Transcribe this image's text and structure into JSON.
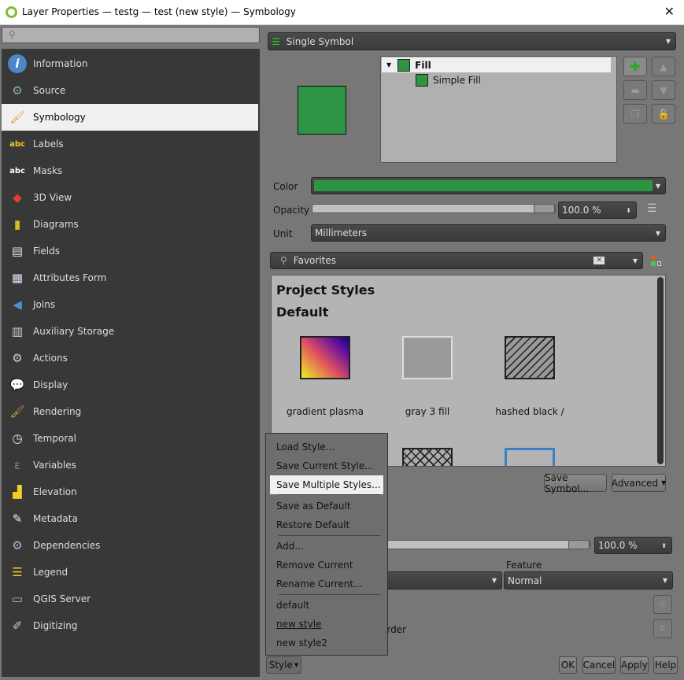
{
  "window": {
    "title": "Layer Properties — testg — test (new style) — Symbology",
    "close_icon": "close-icon"
  },
  "sidebar": {
    "search_placeholder": "",
    "items": [
      {
        "label": "Information",
        "icon": "info-icon",
        "color": "#4a86c8",
        "glyph": "i"
      },
      {
        "label": "Source",
        "icon": "source-icon",
        "color": "#8aa",
        "glyph": "⚙"
      },
      {
        "label": "Symbology",
        "icon": "symbology-icon",
        "color": "#d9a040",
        "glyph": "🖌"
      },
      {
        "label": "Labels",
        "icon": "labels-icon",
        "color": "#f0d020",
        "glyph": "abc"
      },
      {
        "label": "Masks",
        "icon": "masks-icon",
        "color": "#fff",
        "glyph": "abc"
      },
      {
        "label": "3D View",
        "icon": "3d-view-icon",
        "color": "#e04030",
        "glyph": "◆"
      },
      {
        "label": "Diagrams",
        "icon": "diagrams-icon",
        "color": "#d0c020",
        "glyph": "▮"
      },
      {
        "label": "Fields",
        "icon": "fields-icon",
        "color": "#d8e4f0",
        "glyph": "▤"
      },
      {
        "label": "Attributes Form",
        "icon": "attributes-form-icon",
        "color": "#d8e4f0",
        "glyph": "▦"
      },
      {
        "label": "Joins",
        "icon": "joins-icon",
        "color": "#5090d0",
        "glyph": "◀"
      },
      {
        "label": "Auxiliary Storage",
        "icon": "auxiliary-storage-icon",
        "color": "#ccc",
        "glyph": "▥"
      },
      {
        "label": "Actions",
        "icon": "actions-icon",
        "color": "#ccc",
        "glyph": "⚙"
      },
      {
        "label": "Display",
        "icon": "display-icon",
        "color": "#f0e090",
        "glyph": "💬"
      },
      {
        "label": "Rendering",
        "icon": "rendering-icon",
        "color": "#d9a040",
        "glyph": "🖌"
      },
      {
        "label": "Temporal",
        "icon": "temporal-icon",
        "color": "#eee",
        "glyph": "◷"
      },
      {
        "label": "Variables",
        "icon": "variables-icon",
        "color": "#888",
        "glyph": "ε"
      },
      {
        "label": "Elevation",
        "icon": "elevation-icon",
        "color": "#f0d020",
        "glyph": "▟"
      },
      {
        "label": "Metadata",
        "icon": "metadata-icon",
        "color": "#eee",
        "glyph": "✎"
      },
      {
        "label": "Dependencies",
        "icon": "dependencies-icon",
        "color": "#9bd",
        "glyph": "⚙"
      },
      {
        "label": "Legend",
        "icon": "legend-icon",
        "color": "#f0d020",
        "glyph": "☰"
      },
      {
        "label": "QGIS Server",
        "icon": "qgis-server-icon",
        "color": "#9bd",
        "glyph": "▭"
      },
      {
        "label": "Digitizing",
        "icon": "digitizing-icon",
        "color": "#ccc",
        "glyph": "✐"
      }
    ]
  },
  "renderer": {
    "selected": "Single Symbol"
  },
  "symbol_tree": [
    {
      "label": "Fill",
      "color": "#2e9444"
    },
    {
      "label": "Simple Fill",
      "color": "#2e9444"
    }
  ],
  "symbol_color": "#2e9444",
  "properties": {
    "color_label": "Color",
    "opacity_label": "Opacity",
    "opacity_value": "100.0 %",
    "opacity": 100,
    "unit_label": "Unit",
    "unit_value": "Millimeters"
  },
  "library": {
    "filter_value": "Favorites",
    "group_headers": [
      "Project Styles",
      "Default"
    ],
    "symbols": [
      "gradient  plasma",
      "gray 3 fill",
      "hashed black /"
    ],
    "save_symbol": "Save Symbol...",
    "advanced": "Advanced"
  },
  "layer_rendering": {
    "opacity_value": "100.0 %",
    "opacity": 100,
    "feature_label": "Feature",
    "blend_feature": "Normal",
    "order_fragment": "order"
  },
  "style_menu": {
    "items": [
      "Load Style...",
      "Save Current Style...",
      "Save Multiple Styles...",
      "Save as Default",
      "Restore Default",
      "Add...",
      "Remove Current",
      "Rename Current...",
      "default",
      "new style",
      "new style2"
    ],
    "highlighted": "Save Multiple Styles...",
    "current": "new style"
  },
  "footer": {
    "style": "Style",
    "ok": "OK",
    "cancel": "Cancel",
    "apply": "Apply",
    "help": "Help"
  }
}
